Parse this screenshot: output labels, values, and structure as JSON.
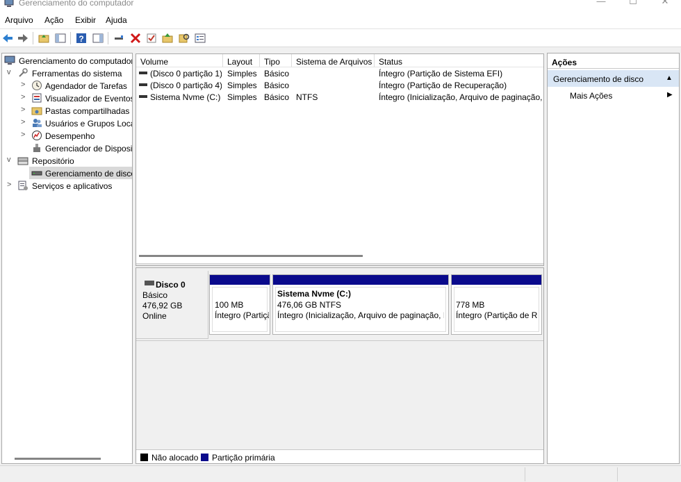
{
  "window": {
    "title": "Gerenciamento do computador",
    "controls": [
      "minimize-icon",
      "maximize-icon",
      "close-icon"
    ]
  },
  "menu": [
    "Arquivo",
    "Ação",
    "Exibir",
    "Ajuda"
  ],
  "toolbar": {
    "icons": [
      "back-arrow-icon",
      "forward-arrow-icon",
      "up-folder-icon",
      "show-hide-tree-icon",
      "help-icon",
      "show-hide-action-pane-icon",
      "connect-icon",
      "delete-icon",
      "check-icon",
      "new-folder-icon",
      "search-icon",
      "properties-icon"
    ]
  },
  "tree": {
    "items": [
      {
        "label": "Gerenciamento do computador",
        "icon": "computer-management-icon",
        "level": 0,
        "expander": ""
      },
      {
        "label": "Ferramentas do sistema",
        "icon": "system-tools-icon",
        "level": 1,
        "expander": "v"
      },
      {
        "label": "Agendador de Tarefas",
        "icon": "clock-icon",
        "level": 2,
        "expander": ">"
      },
      {
        "label": "Visualizador de Eventos",
        "icon": "event-viewer-icon",
        "level": 2,
        "expander": ">"
      },
      {
        "label": "Pastas compartilhadas",
        "icon": "shared-folder-icon",
        "level": 2,
        "expander": ">"
      },
      {
        "label": "Usuários e Grupos Locais",
        "icon": "users-icon",
        "level": 2,
        "expander": ">"
      },
      {
        "label": "Desempenho",
        "icon": "performance-icon",
        "level": 2,
        "expander": ">"
      },
      {
        "label": "Gerenciador de Dispositivos",
        "icon": "device-manager-icon",
        "level": 2,
        "expander": ""
      },
      {
        "label": "Repositório",
        "icon": "storage-icon",
        "level": 1,
        "expander": "v"
      },
      {
        "label": "Gerenciamento de disco",
        "icon": "disk-management-icon",
        "level": 2,
        "expander": "",
        "selected": true
      },
      {
        "label": "Serviços e aplicativos",
        "icon": "services-icon",
        "level": 1,
        "expander": ">"
      }
    ]
  },
  "volumes": {
    "columns": [
      "Volume",
      "Layout",
      "Tipo",
      "Sistema de Arquivos",
      "Status"
    ],
    "rows": [
      [
        "(Disco 0 partição 1)",
        "Simples",
        "Básico",
        "",
        "Íntegro (Partição de Sistema EFI)"
      ],
      [
        "(Disco 0 partição 4)",
        "Simples",
        "Básico",
        "",
        "Íntegro (Partição de Recuperação)"
      ],
      [
        "Sistema Nvme (C:)",
        "Simples",
        "Básico",
        "NTFS",
        "Íntegro (Inicialização, Arquivo de paginação, Despejo, Partição de Dados Básicos)"
      ]
    ]
  },
  "disk": {
    "name": "Disco 0",
    "type": "Básico",
    "size": "476,92 GB",
    "state": "Online",
    "partitions": [
      {
        "title": "",
        "line1": "100 MB",
        "line2": "Íntegro (Partição de Sistema EFI)"
      },
      {
        "title": "Sistema Nvme  (C:)",
        "line1": "476,06 GB NTFS",
        "line2": "Íntegro (Inicialização, Arquivo de paginação, Despejo, Partição de Dados Básicos)"
      },
      {
        "title": "",
        "line1": "778 MB",
        "line2": "Íntegro (Partição de Recuperação)"
      }
    ]
  },
  "legend": [
    {
      "label": "Não alocado",
      "color": "#000000"
    },
    {
      "label": "Partição primária",
      "color": "#0a0a8c"
    }
  ],
  "actions": {
    "header": "Ações",
    "section": "Gerenciamento de disco",
    "more": "Mais Ações"
  }
}
